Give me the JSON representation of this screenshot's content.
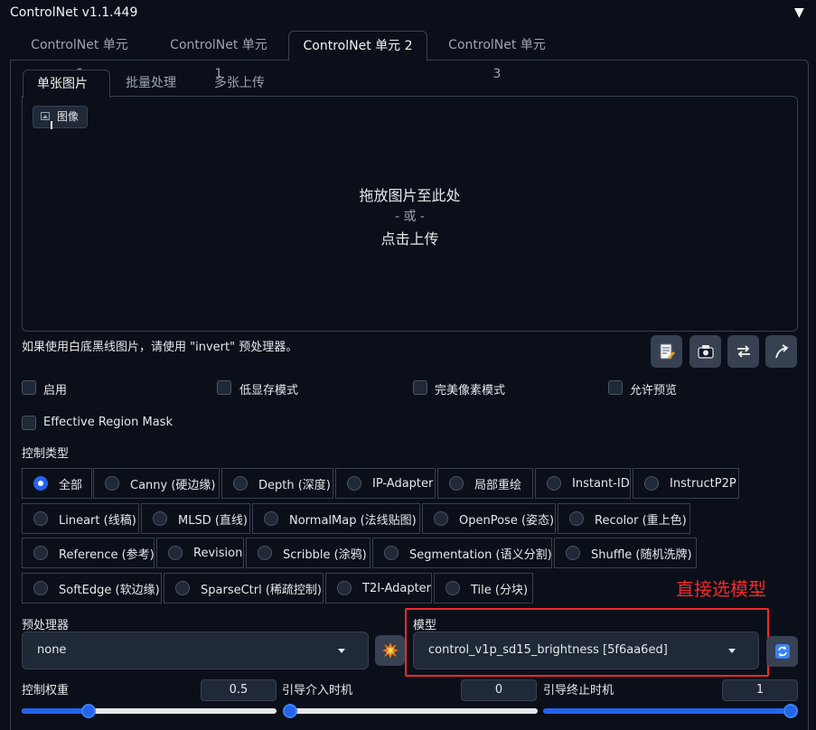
{
  "header": {
    "title": "ControlNet v1.1.449",
    "collapse_icon": "▼"
  },
  "unit_tabs": [
    {
      "label": "ControlNet 单元 0",
      "active": false
    },
    {
      "label": "ControlNet 单元 1",
      "active": false
    },
    {
      "label": "ControlNet 单元 2",
      "active": true
    },
    {
      "label": "ControlNet 单元 3",
      "active": false
    }
  ],
  "mode_tabs": [
    {
      "label": "单张图片",
      "active": true
    },
    {
      "label": "批量处理",
      "active": false
    },
    {
      "label": "多张上传",
      "active": false
    }
  ],
  "image_input": {
    "label": "图像",
    "drop_text": "拖放图片至此处",
    "or_text": "- 或 -",
    "click_text": "点击上传"
  },
  "hint": "如果使用白底黑线图片，请使用 \"invert\" 预处理器。",
  "tool_buttons": [
    "edit-note-icon",
    "camera-icon",
    "swap-icon",
    "send-arrow-icon"
  ],
  "checkboxes": {
    "enable": {
      "label": "启用",
      "checked": false
    },
    "low_vram": {
      "label": "低显存模式",
      "checked": false
    },
    "pixel_perfect": {
      "label": "完美像素模式",
      "checked": false
    },
    "allow_preview": {
      "label": "允许预览",
      "checked": false
    },
    "effective_region_mask": {
      "label": "Effective Region Mask",
      "checked": false
    }
  },
  "control_type": {
    "label": "控制类型",
    "selected": "全部",
    "options": [
      "全部",
      "Canny (硬边缘)",
      "Depth (深度)",
      "IP-Adapter",
      "局部重绘",
      "Instant-ID",
      "InstructP2P",
      "Lineart (线稿)",
      "MLSD (直线)",
      "NormalMap (法线贴图)",
      "OpenPose (姿态)",
      "Recolor (重上色)",
      "Reference (参考)",
      "Revision",
      "Scribble (涂鸦)",
      "Segmentation (语义分割)",
      "Shuffle (随机洗牌)",
      "SoftEdge (软边缘)",
      "SparseCtrl (稀疏控制)",
      "T2I-Adapter",
      "Tile (分块)"
    ]
  },
  "annotation": "直接选模型",
  "preprocessor": {
    "label": "预处理器",
    "value": "none"
  },
  "model": {
    "label": "模型",
    "value": "control_v1p_sd15_brightness [5f6aa6ed]"
  },
  "sliders": {
    "weight": {
      "label": "控制权重",
      "value": "0.5",
      "fraction": 0.25
    },
    "start": {
      "label": "引导介入时机",
      "value": "0",
      "fraction": 0.0
    },
    "end": {
      "label": "引导终止时机",
      "value": "1",
      "fraction": 1.0
    }
  },
  "colors": {
    "accent": "#2563eb",
    "annotation": "#ef2b2b",
    "background": "#0b0f19"
  }
}
